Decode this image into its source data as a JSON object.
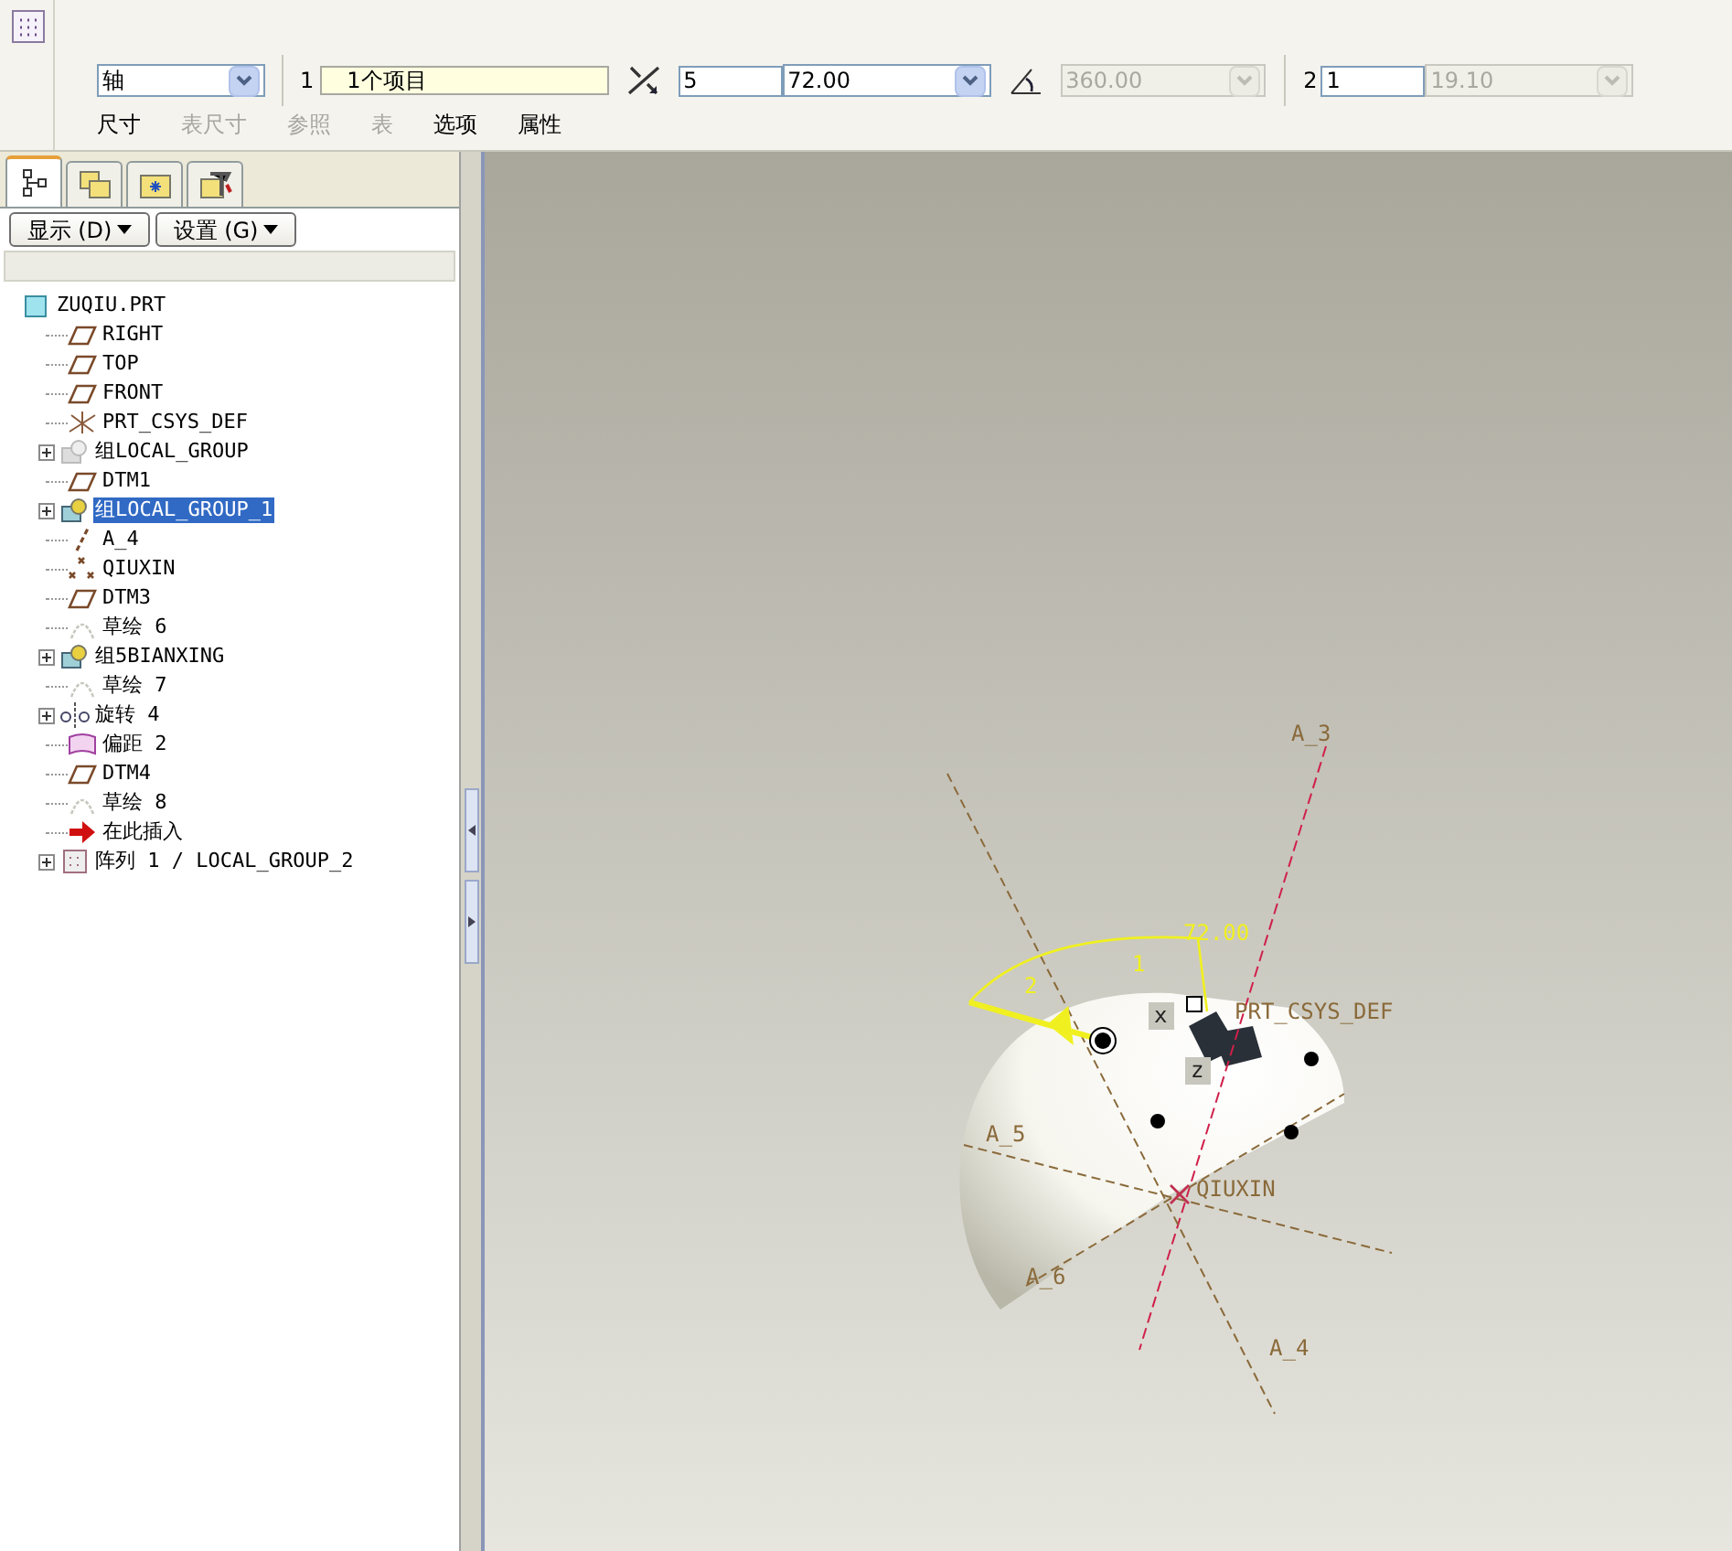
{
  "toolbar": {
    "reference_type": {
      "value": "轴"
    },
    "first_direction": {
      "label": "1",
      "collector": "1个项目",
      "count": "5",
      "increment": "72.00",
      "total": {
        "value": "360.00",
        "disabled": true
      }
    },
    "second_direction": {
      "label": "2",
      "count": "1",
      "increment": {
        "value": "19.10",
        "disabled": true
      }
    }
  },
  "panel_tabs": [
    {
      "label": "尺寸",
      "disabled": false
    },
    {
      "label": "表尺寸",
      "disabled": true
    },
    {
      "label": "参照",
      "disabled": true
    },
    {
      "label": "表",
      "disabled": true
    },
    {
      "label": "选项",
      "disabled": false
    },
    {
      "label": "属性",
      "disabled": false
    }
  ],
  "navigator_tabs": [
    {
      "kind": "tree",
      "selected": true
    },
    {
      "kind": "layers",
      "selected": false
    },
    {
      "kind": "folder",
      "selected": false
    },
    {
      "kind": "favorites",
      "selected": false
    }
  ],
  "navigator_buttons": [
    {
      "label": "显示 (D)"
    },
    {
      "label": "设置 (G)"
    }
  ],
  "model_tree": {
    "label": "ZUQIU.PRT",
    "kind": "part",
    "selected": false,
    "children": [
      {
        "label": "RIGHT",
        "kind": "plane",
        "expandable": false,
        "selected": false
      },
      {
        "label": "TOP",
        "kind": "plane",
        "expandable": false,
        "selected": false
      },
      {
        "label": "FRONT",
        "kind": "plane",
        "expandable": false,
        "selected": false
      },
      {
        "label": "PRT_CSYS_DEF",
        "kind": "csys",
        "expandable": false,
        "selected": false
      },
      {
        "label": "组LOCAL_GROUP",
        "kind": "group_faded",
        "expandable": true,
        "selected": false
      },
      {
        "label": "DTM1",
        "kind": "plane",
        "expandable": false,
        "selected": false
      },
      {
        "label": "组LOCAL_GROUP_1",
        "kind": "group",
        "expandable": true,
        "selected": true
      },
      {
        "label": "A_4",
        "kind": "axis",
        "expandable": false,
        "selected": false
      },
      {
        "label": "QIUXIN",
        "kind": "point",
        "expandable": false,
        "selected": false
      },
      {
        "label": "DTM3",
        "kind": "plane",
        "expandable": false,
        "selected": false
      },
      {
        "label": "草绘 6",
        "kind": "sketch",
        "expandable": false,
        "selected": false
      },
      {
        "label": "组5BIANXING",
        "kind": "group",
        "expandable": true,
        "selected": false
      },
      {
        "label": "草绘 7",
        "kind": "sketch",
        "expandable": false,
        "selected": false
      },
      {
        "label": "旋转 4",
        "kind": "revolve",
        "expandable": true,
        "selected": false
      },
      {
        "label": "偏距 2",
        "kind": "offset",
        "expandable": false,
        "selected": false
      },
      {
        "label": "DTM4",
        "kind": "plane",
        "expandable": false,
        "selected": false
      },
      {
        "label": "草绘 8",
        "kind": "sketch",
        "expandable": false,
        "selected": false
      },
      {
        "label": "在此插入",
        "kind": "insert",
        "expandable": false,
        "selected": false
      },
      {
        "label": "阵列 1 / LOCAL_GROUP_2",
        "kind": "pattern",
        "expandable": true,
        "selected": false
      }
    ]
  },
  "viewport": {
    "labels": [
      {
        "text": "A_3",
        "kind": "axis"
      },
      {
        "text": "72.00",
        "kind": "dimension"
      },
      {
        "text": "1",
        "kind": "direction"
      },
      {
        "text": "2",
        "kind": "direction"
      },
      {
        "text": "x",
        "kind": "csys_axis"
      },
      {
        "text": "PRT_CSYS_DEF",
        "kind": "csys"
      },
      {
        "text": "z",
        "kind": "csys_axis"
      },
      {
        "text": "A_5",
        "kind": "axis"
      },
      {
        "text": "QIUXIN",
        "kind": "point"
      },
      {
        "text": "A_6",
        "kind": "axis"
      },
      {
        "text": "A_4",
        "kind": "axis"
      }
    ]
  }
}
